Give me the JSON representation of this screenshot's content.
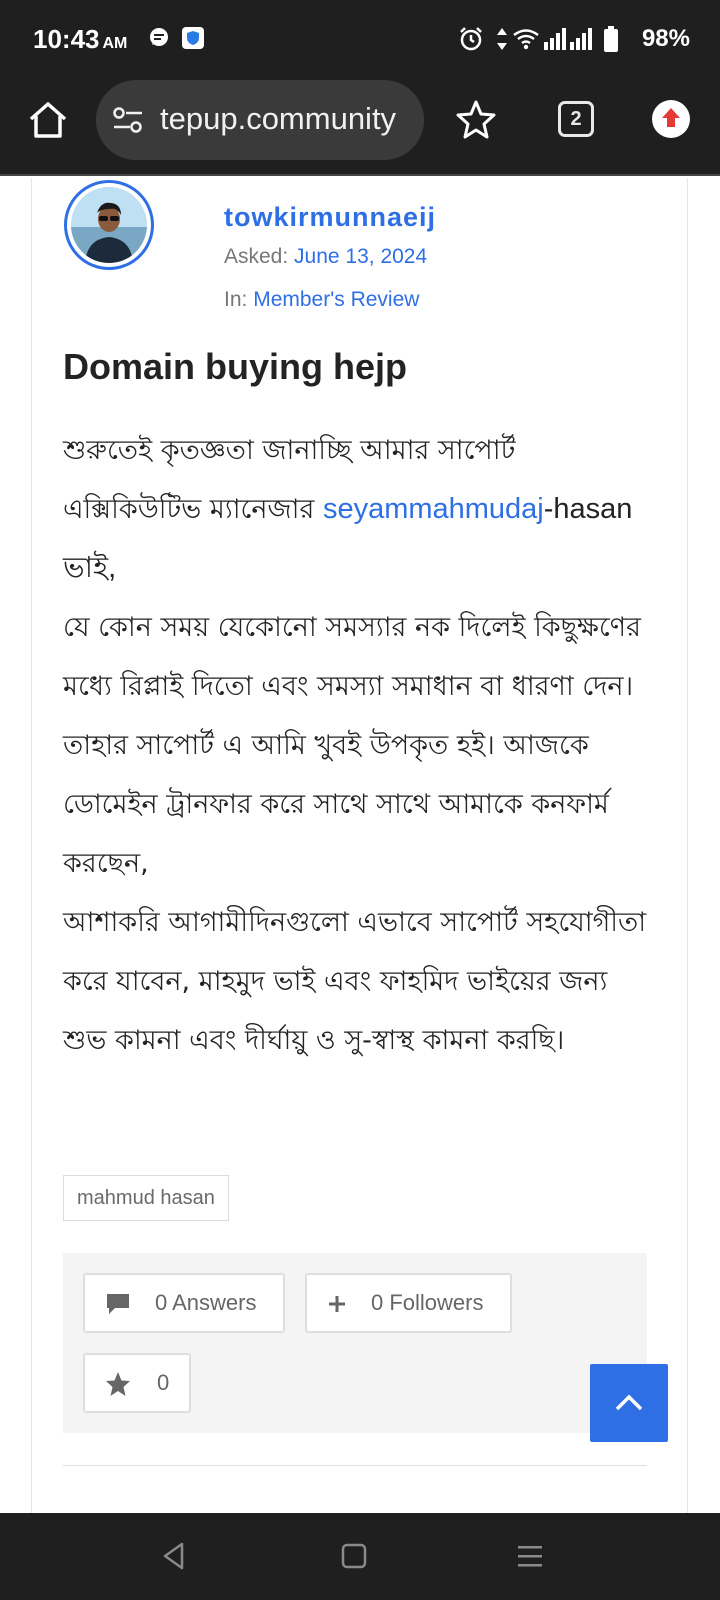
{
  "status_bar": {
    "time": "10:43",
    "ampm": "AM",
    "battery": "98%",
    "icons": [
      "message-icon",
      "shield-app-icon",
      "alarm-icon",
      "data-arrows-icon",
      "wifi-icon",
      "signal-icon",
      "signal-icon",
      "battery-icon"
    ]
  },
  "browser": {
    "url": "tepup.community",
    "tab_count": "2",
    "icons": [
      "home-icon",
      "site-settings-icon",
      "star-icon",
      "tabs-icon",
      "update-menu-icon"
    ]
  },
  "question": {
    "author": "towkirmunnaeij",
    "asked_label": "Asked:",
    "asked_date": "June 13, 2024",
    "in_label": "In:",
    "category": "Member's Review",
    "title": "Domain buying hejp",
    "body": {
      "line1": "শুরুতেই কৃতজ্ঞতা জানাচ্ছি আমার সাপোর্ট এক্সিকিউটিভ ম্যানেজার",
      "mention": "seyammahmudaj",
      "line1_tail": "-hasan ভাই,",
      "line2": "যে কোন সময় যেকোনো সমস্যার নক দিলেই কিছুক্ষণের মধ্যে রিপ্লাই দিতো এবং সমস্যা সমাধান বা ধারণা দেন। তাহার সাপোর্ট এ আমি খুবই উপকৃত হই। আজকে ডোমেইন ট্রানফার করে সাথে সাথে আমাকে কনফার্ম করছেন,",
      "line3": "আশাকরি আগামীদিনগুলো এভাবে সাপোর্ট সহযোগীতা করে যাবেন, মাহমুদ ভাই এবং ফাহমিদ ভাইয়ের জন্য শুভ কামনা এবং দীর্ঘায়ু ও সু-স্বাস্থ কামনা করছি।"
    },
    "tag": "mahmud hasan",
    "answers_label": "0 Answers",
    "followers_label": "0 Followers",
    "favorites_count": "0"
  },
  "colors": {
    "accent": "#2f6fe6",
    "dark_bar": "#1f1f1f"
  }
}
